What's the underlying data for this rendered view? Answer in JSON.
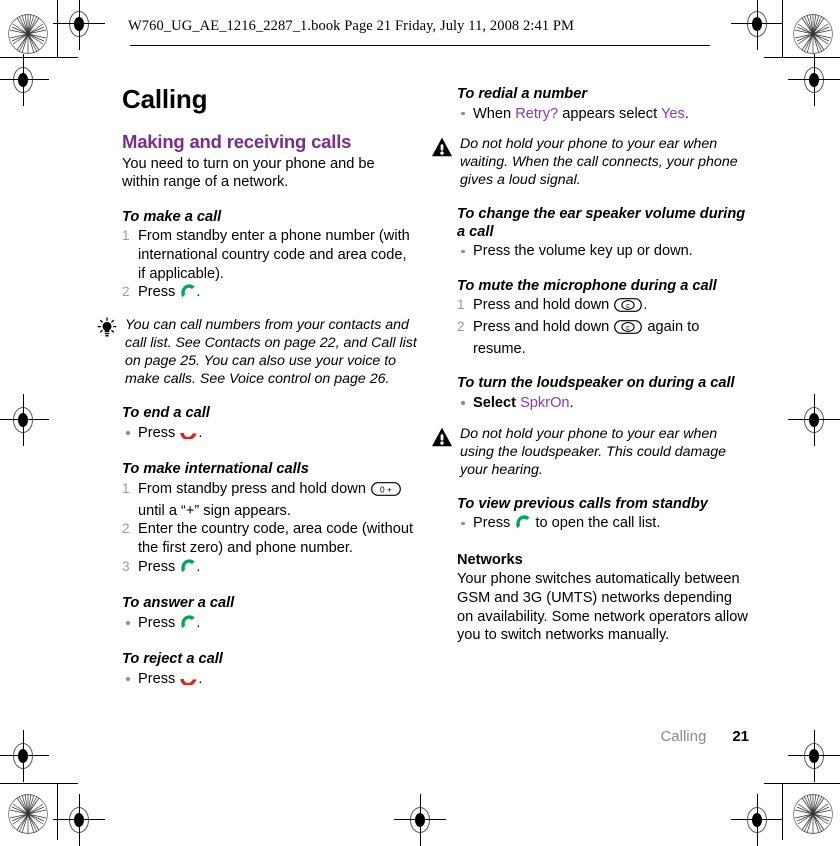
{
  "header": {
    "text": "W760_UG_AE_1216_2287_1.book  Page 21  Friday, July 11, 2008  2:41 PM"
  },
  "doc": {
    "title": "Calling",
    "section_title": "Making and receiving calls",
    "intro": "You need to turn on your phone and be within range of a network."
  },
  "left_column": {
    "make_call": {
      "title": "To make a call",
      "steps": [
        "From standby enter a phone number (with international country code and area code, if applicable).",
        "Press ."
      ]
    },
    "tip": {
      "icon": "lightbulb-icon",
      "text": "You can call numbers from your contacts and call list. See Contacts on page 22, and Call list on page 25. You can also use your voice to make calls. See Voice control on page 26."
    },
    "end_call": {
      "title": "To end a call",
      "step": "Press ."
    },
    "international": {
      "title": "To make international calls",
      "step1_before": "From standby press and hold down",
      "step1_key": "0 +",
      "step1_after": "until a “+” sign appears.",
      "step2": "Enter the country code, area code (without the first zero) and phone number.",
      "step3": "Press ."
    },
    "answer_call": {
      "title": "To answer a call",
      "step": "Press ."
    },
    "reject_call": {
      "title": "To reject a call",
      "step": "Press ."
    }
  },
  "right_column": {
    "redial": {
      "title": "To redial a number",
      "step_before": "When",
      "step_term1": "Retry?",
      "step_middle": "appears select",
      "step_term2": "Yes",
      "step_after": "."
    },
    "warning1": {
      "icon": "warning-triangle-icon",
      "text": "Do not hold your phone to your ear when waiting. When the call connects, your phone gives a loud signal."
    },
    "volume": {
      "title": "To change the ear speaker volume during a call",
      "step": "Press the volume key up or down."
    },
    "mute": {
      "title": "To mute the microphone during a call",
      "step1_before": "Press and hold down",
      "step1_key": "c",
      "step1_after": ".",
      "step2_before": "Press and hold down",
      "step2_key": "c",
      "step2_after": "again to resume."
    },
    "loudspeaker": {
      "title": "To turn the loudspeaker on during a call",
      "step_before": "Select",
      "step_term": "SpkrOn",
      "step_after": "."
    },
    "warning2": {
      "icon": "warning-triangle-icon",
      "text": "Do not hold your phone to your ear when using the loudspeaker. This could damage your hearing."
    },
    "previous_calls": {
      "title": "To view previous calls from standby",
      "step_before": "Press",
      "step_after": "to open the call list."
    },
    "networks": {
      "title": "Networks",
      "body": "Your phone switches automatically between GSM and 3G (UMTS) networks depending on availability. Some network operators allow you to switch networks manually."
    }
  },
  "footer": {
    "chapter": "Calling",
    "page_number": "21"
  },
  "colors": {
    "heading_purple": "#7B2D8E",
    "ui_term_purple": "#8B38B0",
    "call_green": "#00A651",
    "endcall_red": "#E1241B",
    "step_number_gray": "#9a9a9a",
    "footer_gray": "#8a8a8a"
  },
  "icons": {
    "call_green": "green-call-handset-icon",
    "end_call_red": "red-end-call-handset-icon",
    "tip": "lightbulb-icon",
    "warning": "warning-triangle-icon",
    "registration": "registration-target-mark",
    "burst": "registration-burst-mark"
  }
}
